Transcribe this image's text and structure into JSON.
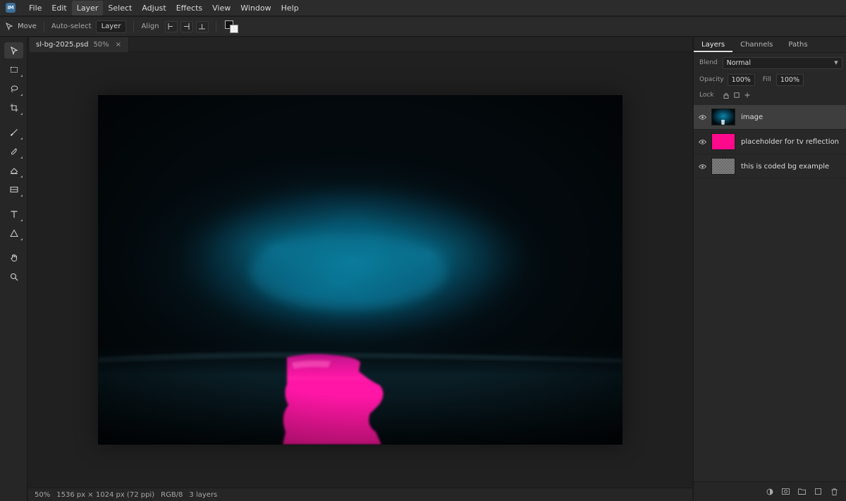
{
  "app": {
    "logo_text": "IM",
    "menu": [
      "File",
      "Edit",
      "Layer",
      "Select",
      "Adjust",
      "Effects",
      "View",
      "Window",
      "Help"
    ],
    "active_menu": "Layer"
  },
  "options": {
    "tool_label": "Move",
    "auto_select_label": "Auto-select",
    "auto_select_value": "Layer",
    "align_label": "Align",
    "align_buttons": [
      "left-align-icon",
      "center-align-icon",
      "bottom-align-icon"
    ],
    "foreground_color": "#111111",
    "background_color": "#f2f2f2"
  },
  "toolbar": {
    "tools": [
      "move-tool",
      "marquee-tool",
      "lasso-tool",
      "crop-tool",
      "brush-tool",
      "smudge-tool",
      "eraser-tool",
      "gradient-tool",
      "text-tool",
      "shape-tool",
      "hand-tool",
      "zoom-tool"
    ],
    "active_tool": "move-tool"
  },
  "document": {
    "filename": "sl-bg-2025.psd",
    "zoom": "50%",
    "close_glyph": "×"
  },
  "status": {
    "zoom": "50%",
    "dimensions": "1536 px × 1024 px (72 ppi)",
    "mode": "RGB/8",
    "layer_count": "3 layers"
  },
  "panel": {
    "tabs": [
      "Layers",
      "Channels",
      "Paths"
    ],
    "active_tab": "Layers",
    "blend_label": "Blend",
    "blend_value": "Normal",
    "opacity_label": "Opacity",
    "opacity_value": "100%",
    "fill_label": "Fill",
    "fill_value": "100%",
    "lock_label": "Lock",
    "layers": [
      {
        "name": "image",
        "selected": true,
        "thumb": "image"
      },
      {
        "name": "placeholder for tv reflection",
        "selected": false,
        "thumb": "#ff0a8c"
      },
      {
        "name": "this is coded bg example",
        "selected": false,
        "thumb": "checker"
      }
    ],
    "footer_icons": [
      "adjustment-layer-icon",
      "mask-icon",
      "folder-icon",
      "new-layer-icon",
      "trash-icon"
    ]
  },
  "colors": {
    "accent_pink": "#ff0a8c",
    "fog_teal": "#0a7fa3"
  }
}
